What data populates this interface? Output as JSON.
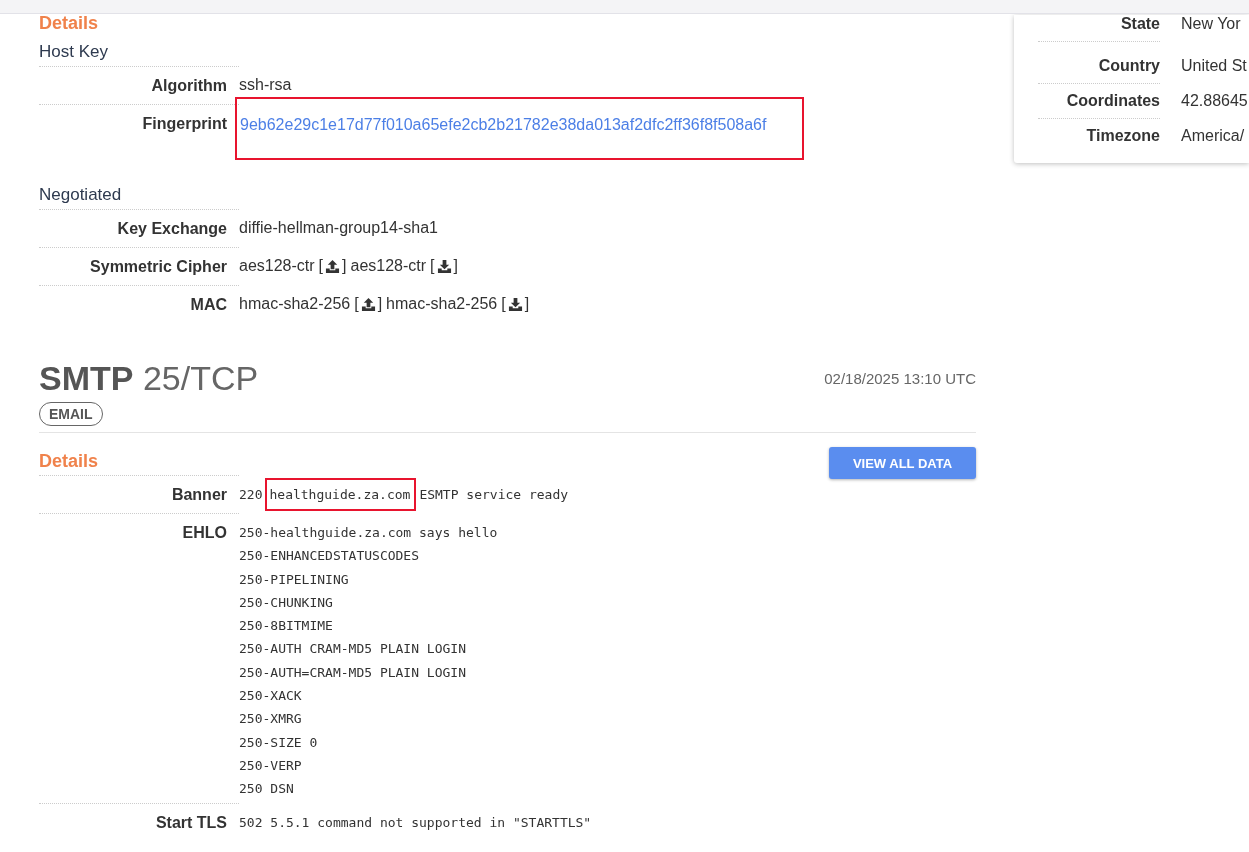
{
  "ssh": {
    "details_title": "Details",
    "host_key": {
      "title": "Host Key",
      "rows": [
        {
          "label": "Algorithm",
          "value": "ssh-rsa"
        },
        {
          "label": "Fingerprint",
          "value": "9eb62e29c1e17d77f010a65efe2cb2b21782e38da013af2dfc2ff36f8f508a6f",
          "kind": "link",
          "highlighted": true
        }
      ]
    },
    "negotiated": {
      "title": "Negotiated",
      "rows": [
        {
          "label": "Key Exchange",
          "value": "diffie-hellman-group14-sha1"
        },
        {
          "label": "Symmetric Cipher",
          "parts": [
            {
              "name": "aes128-ctr",
              "open": "[",
              "kind": "upload",
              "close": "]"
            },
            {
              "name": "aes128-ctr",
              "open": "[",
              "kind": "download",
              "close": "]"
            }
          ]
        },
        {
          "label": "MAC",
          "parts": [
            {
              "name": "hmac-sha2-256",
              "open": "[",
              "kind": "upload",
              "close": "]"
            },
            {
              "name": "hmac-sha2-256",
              "open": "[",
              "kind": "download",
              "close": "]"
            }
          ]
        }
      ]
    }
  },
  "location": [
    {
      "label": "State",
      "value": "New Yor"
    },
    {
      "label": "Country",
      "value": "United St"
    },
    {
      "label": "Coordinates",
      "value": "42.88645"
    },
    {
      "label": "Timezone",
      "value": "America/"
    }
  ],
  "smtp": {
    "name": "SMTP",
    "port": "25/TCP",
    "timestamp": "02/18/2025 13:10 UTC",
    "tags": [
      "EMAIL"
    ],
    "details_title": "Details",
    "button": "VIEW ALL DATA",
    "banner": {
      "label": "Banner",
      "prefix": "220",
      "highlight": "healthguide.za.com",
      "suffix": "ESMTP service ready"
    },
    "ehlo": {
      "label": "EHLO",
      "lines": [
        "250-healthguide.za.com says hello",
        "250-ENHANCEDSTATUSCODES",
        "250-PIPELINING",
        "250-CHUNKING",
        "250-8BITMIME",
        "250-AUTH CRAM-MD5 PLAIN LOGIN",
        "250-AUTH=CRAM-MD5 PLAIN LOGIN",
        "250-XACK",
        "250-XMRG",
        "250-SIZE 0",
        "250-VERP",
        "250 DSN"
      ]
    },
    "starttls": {
      "label": "Start TLS",
      "value": "502 5.5.1 command not supported in \"STARTTLS\""
    }
  }
}
